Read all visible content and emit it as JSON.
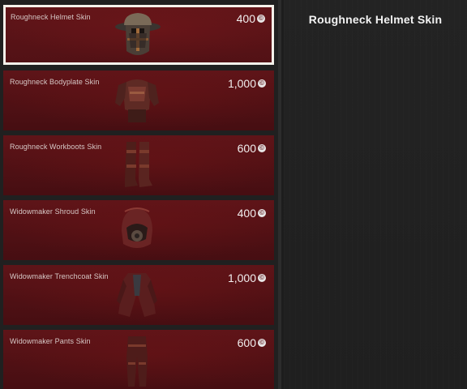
{
  "detail": {
    "title": "Roughneck Helmet Skin"
  },
  "currency": {
    "symbol": "©"
  },
  "items": [
    {
      "name": "Roughneck Helmet Skin",
      "price": "400",
      "icon": "helmet-icon",
      "selected": true
    },
    {
      "name": "Roughneck Bodyplate Skin",
      "price": "1,000",
      "icon": "bodyplate-icon",
      "selected": false
    },
    {
      "name": "Roughneck Workboots Skin",
      "price": "600",
      "icon": "boots-icon",
      "selected": false
    },
    {
      "name": "Widowmaker Shroud Skin",
      "price": "400",
      "icon": "hood-icon",
      "selected": false
    },
    {
      "name": "Widowmaker Trenchcoat Skin",
      "price": "1,000",
      "icon": "trenchcoat-icon",
      "selected": false
    },
    {
      "name": "Widowmaker Pants Skin",
      "price": "600",
      "icon": "pants-icon",
      "selected": false
    }
  ],
  "colors": {
    "card": "#5a1317",
    "selected_border": "#f4f1ea",
    "panel": "#212121"
  }
}
